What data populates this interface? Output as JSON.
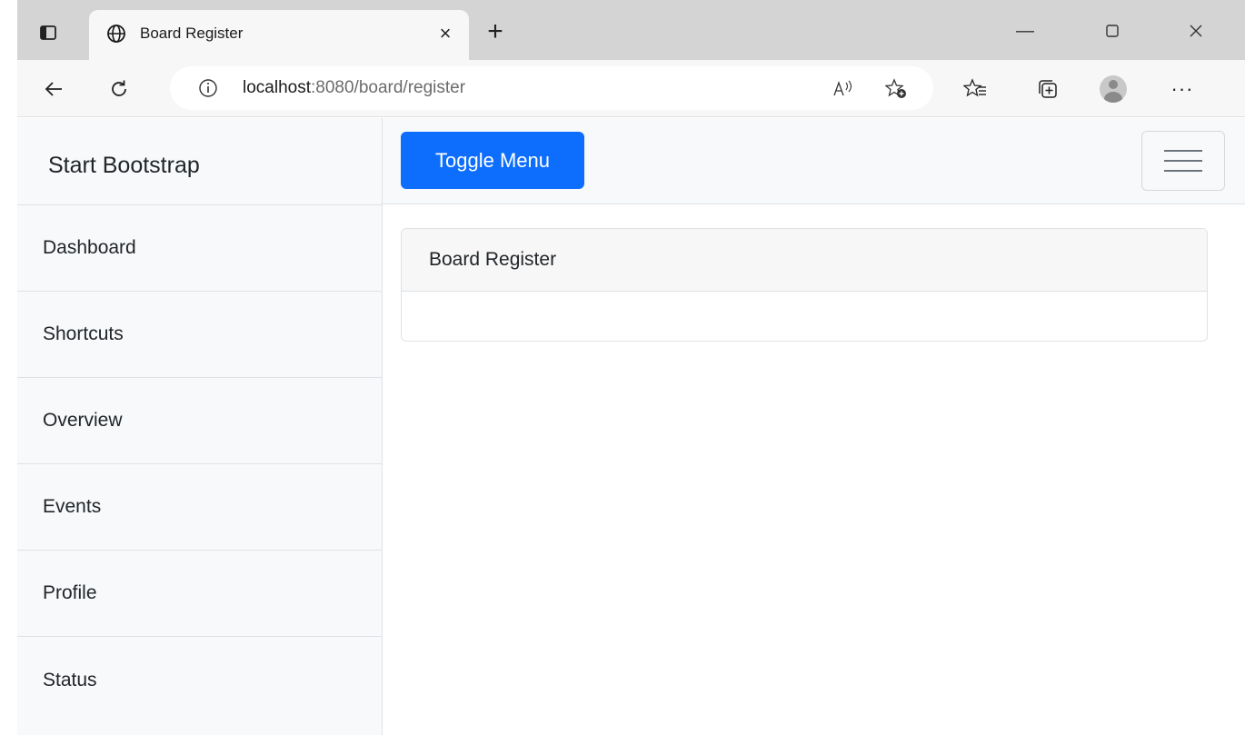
{
  "browser": {
    "tab": {
      "title": "Board Register",
      "favicon": "globe-icon"
    },
    "address": {
      "host": "localhost",
      "rest": ":8080/board/register"
    }
  },
  "app": {
    "sidebar": {
      "heading": "Start Bootstrap",
      "items": [
        {
          "label": "Dashboard"
        },
        {
          "label": "Shortcuts"
        },
        {
          "label": "Overview"
        },
        {
          "label": "Events"
        },
        {
          "label": "Profile"
        },
        {
          "label": "Status"
        }
      ]
    },
    "topnav": {
      "toggle_label": "Toggle Menu"
    },
    "card": {
      "header": "Board Register"
    }
  },
  "colors": {
    "primary": "#0d6efd",
    "sidebar_bg": "#f8f9fa",
    "border": "#dee2e6"
  }
}
